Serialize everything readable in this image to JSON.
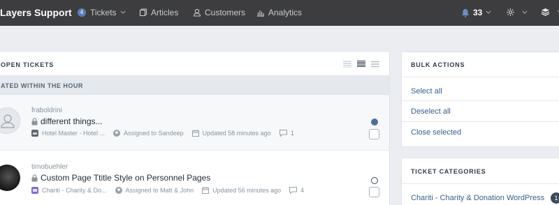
{
  "header": {
    "brand": "Layers Support",
    "nav": {
      "tickets": {
        "count": "4",
        "label": "Tickets"
      },
      "articles": "Articles",
      "customers": "Customers",
      "analytics": "Analytics"
    },
    "notifications": "33"
  },
  "tickets_panel": {
    "title": "OPEN TICKETS",
    "group_title": "ATED WITHIN THE HOUR",
    "tickets": [
      {
        "user": "fraboldrini",
        "subject": "different things...",
        "product": "Hotel Master - Hotel ...",
        "assigned": "Assigned to Sandeep",
        "updated": "Updated 58 minutes ago",
        "comments": "1",
        "status": "filled"
      },
      {
        "user": "timobuehler",
        "subject": "Custom Page Ttitle Style on Personnel Pages",
        "product": "Chariti - Charity & Do...",
        "assigned": "Assigned to Matt & John",
        "updated": "Updated 56 minutes ago",
        "comments": "4",
        "status": "open"
      }
    ]
  },
  "bulk_actions": {
    "title": "BULK ACTIONS",
    "select_all": "Select all",
    "deselect_all": "Deselect all",
    "close_selected": "Close selected"
  },
  "ticket_categories": {
    "title": "TICKET CATEGORIES",
    "items": [
      {
        "label": "Chariti - Charity & Donation WordPress",
        "count": "1"
      }
    ]
  },
  "colors": {
    "topbar": "#3d3d3f",
    "link": "#3a5f88",
    "status_filled": "#4f6e96"
  }
}
